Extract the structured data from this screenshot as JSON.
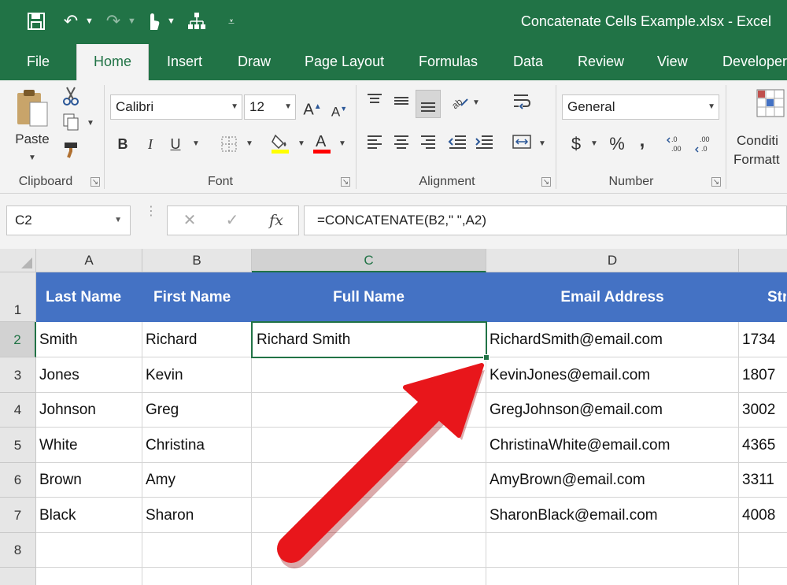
{
  "window": {
    "title": "Concatenate Cells Example.xlsx - Excel"
  },
  "ribbon_tabs": [
    {
      "label": "File"
    },
    {
      "label": "Home"
    },
    {
      "label": "Insert"
    },
    {
      "label": "Draw"
    },
    {
      "label": "Page Layout"
    },
    {
      "label": "Formulas"
    },
    {
      "label": "Data"
    },
    {
      "label": "Review"
    },
    {
      "label": "View"
    },
    {
      "label": "Developer"
    }
  ],
  "active_tab": "Home",
  "ribbon": {
    "clipboard": {
      "group_label": "Clipboard",
      "paste_label": "Paste"
    },
    "font": {
      "group_label": "Font",
      "font_name": "Calibri",
      "font_size": "12",
      "bold": "B",
      "italic": "I",
      "underline": "U",
      "highlight_color": "#ffff00",
      "font_color": "#ff0000"
    },
    "alignment": {
      "group_label": "Alignment"
    },
    "number": {
      "group_label": "Number",
      "format": "General",
      "currency": "$",
      "percent": "%",
      "comma": ","
    },
    "styles": {
      "conditional_line1": "Conditi",
      "conditional_line2": "Formatt"
    }
  },
  "formula_bar": {
    "name_box": "C2",
    "formula": "=CONCATENATE(B2,\" \",A2)"
  },
  "sheet": {
    "columns": [
      "A",
      "B",
      "C",
      "D",
      ""
    ],
    "selected_column": "C",
    "selected_row": "2",
    "row_numbers": [
      "1",
      "2",
      "3",
      "4",
      "5",
      "6",
      "7",
      "8"
    ],
    "header_row": [
      "Last Name",
      "First Name",
      "Full Name",
      "Email Address",
      "Str"
    ],
    "data_rows": [
      [
        "Smith",
        "Richard",
        "Richard Smith",
        "RichardSmith@email.com",
        "1734"
      ],
      [
        "Jones",
        "Kevin",
        "",
        "KevinJones@email.com",
        "1807"
      ],
      [
        "Johnson",
        "Greg",
        "",
        "GregJohnson@email.com",
        "3002"
      ],
      [
        "White",
        "Christina",
        "",
        "ChristinaWhite@email.com",
        "4365"
      ],
      [
        "Brown",
        "Amy",
        "",
        "AmyBrown@email.com",
        "3311"
      ],
      [
        "Black",
        "Sharon",
        "",
        "SharonBlack@email.com",
        "4008"
      ],
      [
        "",
        "",
        "",
        "",
        ""
      ]
    ],
    "header_fill": "#4472c4",
    "selection_color": "#217346"
  },
  "annotation": {
    "arrow_color": "#e8161b"
  }
}
